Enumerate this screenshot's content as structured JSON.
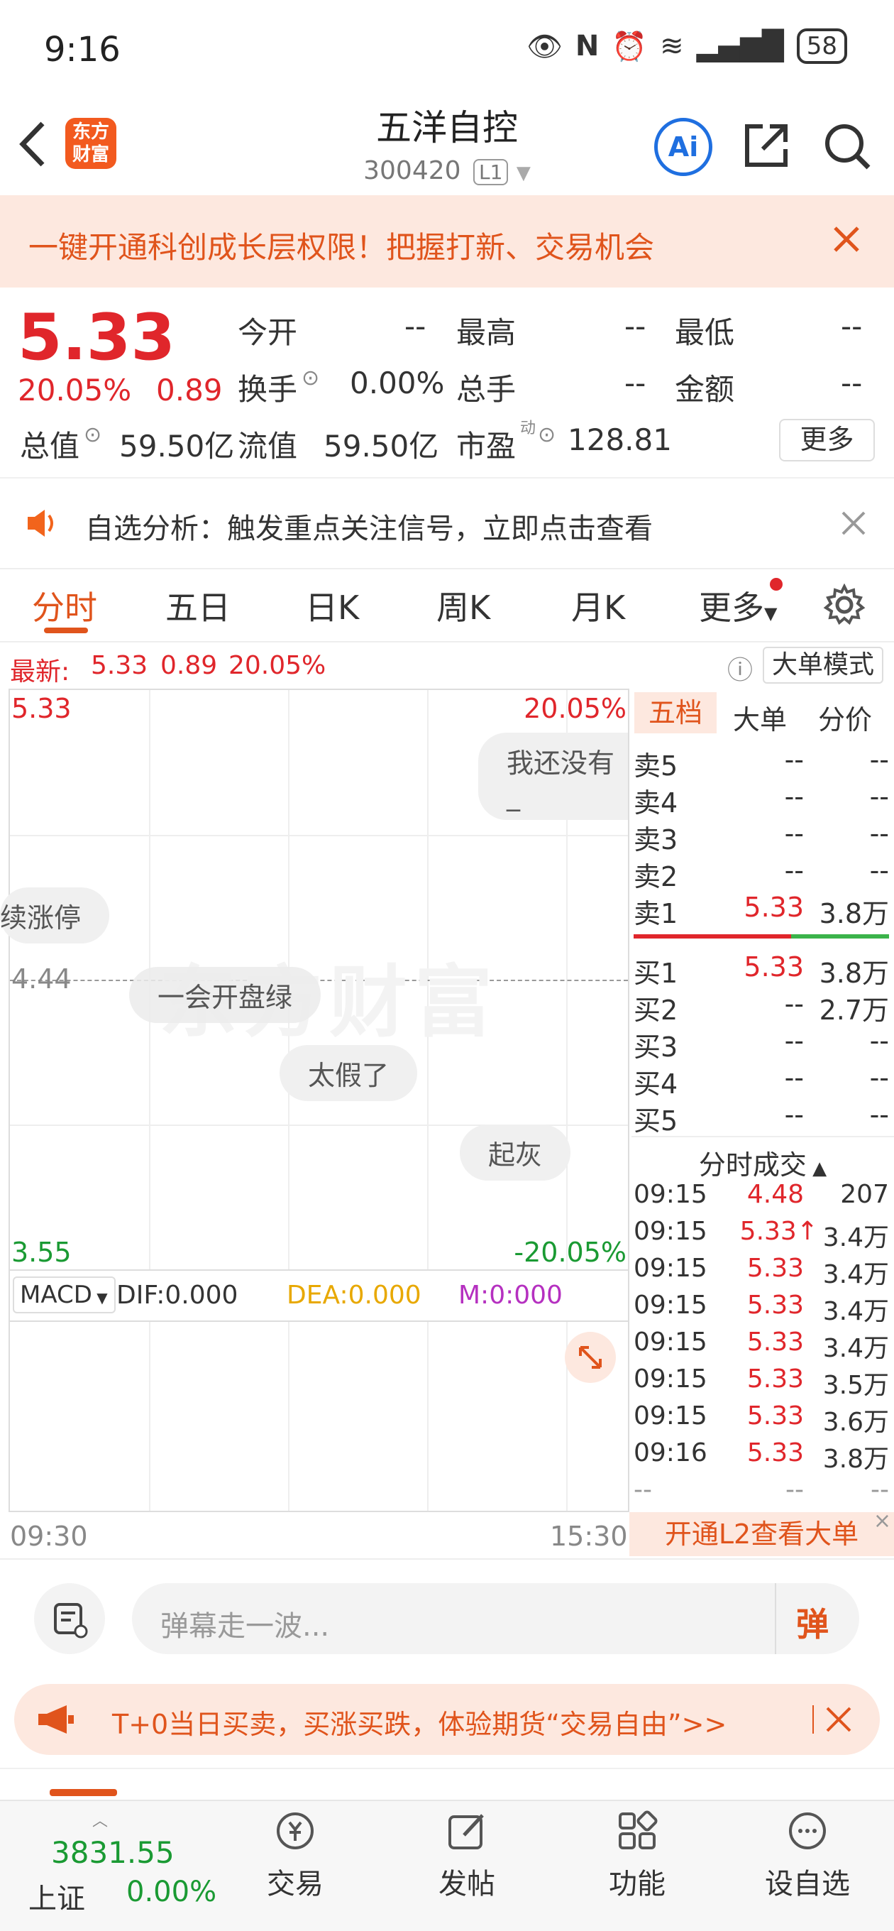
{
  "status_bar": {
    "time": "9:16",
    "battery": "58"
  },
  "header": {
    "title": "五洋自控",
    "code": "300420",
    "level": "L1",
    "logo_text": "东方财富",
    "ai_label": "Ai"
  },
  "banner": {
    "text": "一键开通科创成长层权限！把握打新、交易机会"
  },
  "quote": {
    "price": "5.33",
    "change_pct": "20.05%",
    "change": "0.89",
    "open_label": "今开",
    "open": "--",
    "high_label": "最高",
    "high": "--",
    "low_label": "最低",
    "low": "--",
    "turnover_label": "换手",
    "turnover": "0.00%",
    "volume_label": "总手",
    "volume": "--",
    "amount_label": "金额",
    "amount": "--",
    "mcap_label": "总值",
    "mcap": "59.50亿",
    "float_label": "流值",
    "float": "59.50亿",
    "pe_label": "市盈",
    "pe_sup": "动",
    "pe": "128.81",
    "more": "更多"
  },
  "notice": {
    "text": "自选分析：触发重点关注信号，立即点击查看"
  },
  "tabs": [
    "分时",
    "五日",
    "日K",
    "周K",
    "月K",
    "更多"
  ],
  "chart_info": {
    "latest_label": "最新:",
    "price": "5.33",
    "change": "0.89",
    "pct": "20.05%",
    "mode_button": "大单模式"
  },
  "chart": {
    "top_price": "5.33",
    "top_pct": "20.05%",
    "mid_price": "4.44",
    "bottom_price": "3.55",
    "bottom_pct": "-20.05%",
    "watermark": "东方财富",
    "start_time": "09:30",
    "end_time": "15:30"
  },
  "danmaku": [
    "我还没有_",
    "续涨停",
    "一会开盘绿",
    "太假了",
    "起灰"
  ],
  "macd": {
    "name": "MACD",
    "dif": "DIF:0.000",
    "dea": "DEA:0.000",
    "m": "M:0:000"
  },
  "orderbook": {
    "tabs": [
      "五档",
      "大单",
      "分价"
    ],
    "sells": [
      {
        "name": "卖5",
        "price": "--",
        "vol": "--"
      },
      {
        "name": "卖4",
        "price": "--",
        "vol": "--"
      },
      {
        "name": "卖3",
        "price": "--",
        "vol": "--"
      },
      {
        "name": "卖2",
        "price": "--",
        "vol": "--"
      },
      {
        "name": "卖1",
        "price": "5.33",
        "vol": "3.8万"
      }
    ],
    "buys": [
      {
        "name": "买1",
        "price": "5.33",
        "vol": "3.8万"
      },
      {
        "name": "买2",
        "price": "--",
        "vol": "2.7万"
      },
      {
        "name": "买3",
        "price": "--",
        "vol": "--"
      },
      {
        "name": "买4",
        "price": "--",
        "vol": "--"
      },
      {
        "name": "买5",
        "price": "--",
        "vol": "--"
      }
    ],
    "ticks_title": "分时成交",
    "ticks": [
      {
        "time": "09:15",
        "price": "4.48",
        "vol": "207"
      },
      {
        "time": "09:15",
        "price": "5.33↑",
        "vol": "3.4万"
      },
      {
        "time": "09:15",
        "price": "5.33",
        "vol": "3.4万"
      },
      {
        "time": "09:15",
        "price": "5.33",
        "vol": "3.4万"
      },
      {
        "time": "09:15",
        "price": "5.33",
        "vol": "3.4万"
      },
      {
        "time": "09:15",
        "price": "5.33",
        "vol": "3.5万"
      },
      {
        "time": "09:15",
        "price": "5.33",
        "vol": "3.6万"
      },
      {
        "time": "09:16",
        "price": "5.33",
        "vol": "3.8万"
      },
      {
        "time": "--",
        "price": "--",
        "vol": "--"
      }
    ],
    "l2_promo": "开通L2查看大单"
  },
  "comment": {
    "placeholder": "弹幕走一波...",
    "danmaku_btn": "弹"
  },
  "promo": {
    "text": "T+0当日买卖，买涨买跌，体验期货“交易自由”>>"
  },
  "bottom_nav": {
    "index_value": "3831.55",
    "index_name": "上证",
    "index_pct": "0.00%",
    "items": [
      "交易",
      "发帖",
      "功能",
      "设自选"
    ]
  }
}
